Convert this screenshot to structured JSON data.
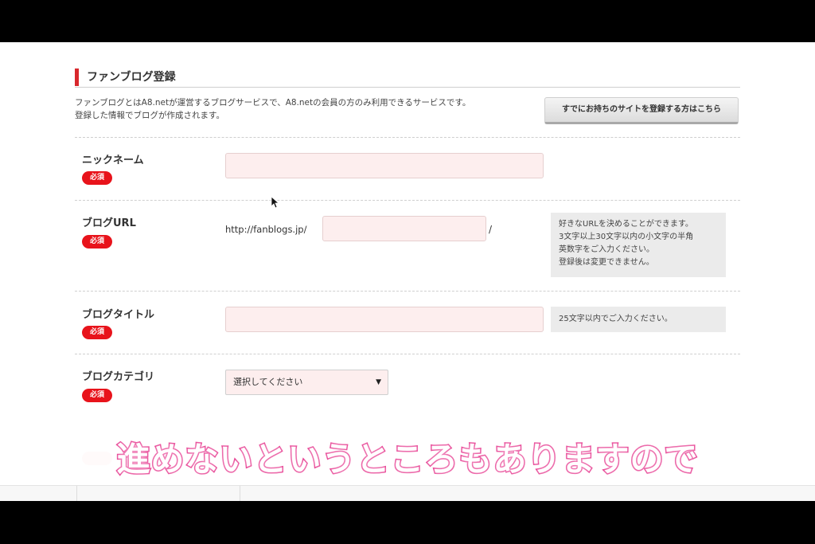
{
  "section": {
    "title": "ファンブログ登録",
    "intro_line1": "ファンブログとはA8.netが運営するブログサービスで、A8.netの会員の方のみ利用できるサービスです。",
    "intro_line2": "登録した情報でブログが作成されます。",
    "existing_site_button": "すでにお持ちのサイトを登録する方はこちら"
  },
  "required_badge": "必須",
  "fields": {
    "nickname": {
      "label": "ニックネーム",
      "value": ""
    },
    "blog_url": {
      "label": "ブログURL",
      "prefix": "http://fanblogs.jp/",
      "suffix": "/",
      "value": "",
      "hint_lines": [
        "好きなURLを決めることができます。",
        "3文字以上30文字以内の小文字の半角",
        "英数字をご入力ください。",
        "登録後は変更できません。"
      ]
    },
    "blog_title": {
      "label": "ブログタイトル",
      "value": "",
      "hint": "25文字以内でご入力ください。"
    },
    "blog_category": {
      "label": "ブログカテゴリ",
      "selected": "選択してください"
    }
  },
  "caption": "進めないというところもありますので",
  "icons": {
    "select_arrow": "▼",
    "cursor": "mouse-pointer-icon"
  },
  "colors": {
    "accent_red": "#d8282d",
    "required_red": "#e8131b",
    "input_pink": "#fdeeee",
    "caption_outline": "#e6388e"
  }
}
